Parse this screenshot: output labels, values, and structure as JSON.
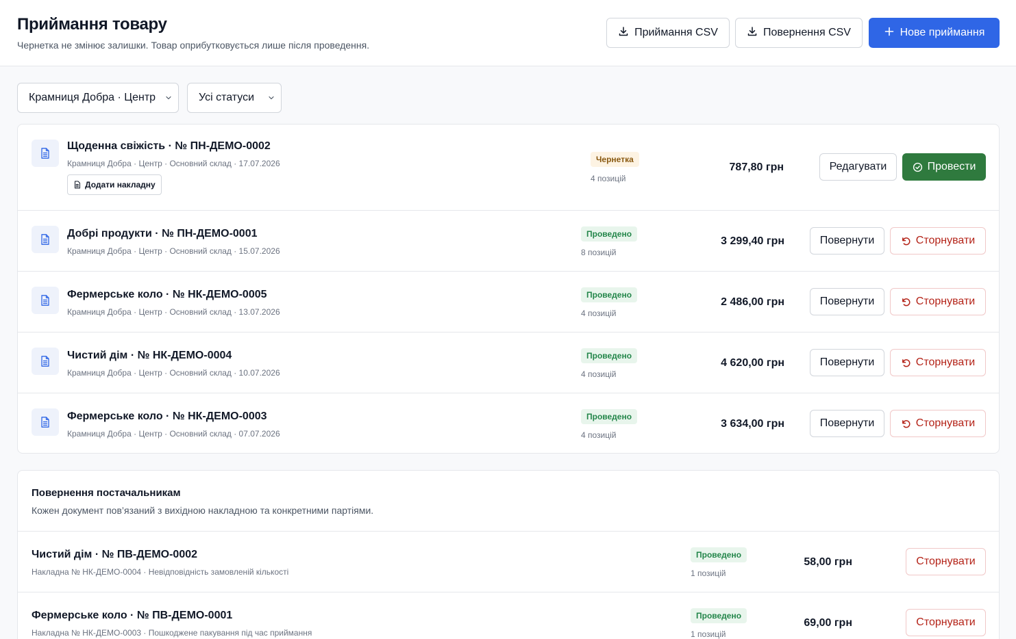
{
  "header": {
    "title": "Приймання товару",
    "subtitle": "Чернетка не змінює залишки. Товар оприбутковується лише після проведення.",
    "receipt_csv": "Приймання CSV",
    "return_csv": "Повернення CSV",
    "new_receipt": "Нове приймання"
  },
  "filters": {
    "store": "Крамниця Добра · Центр",
    "status": "Усі статуси"
  },
  "receipts": [
    {
      "title": "Щоденна свіжість · № ПН-ДЕМО-0002",
      "meta": "Крамниця Добра · Центр · Основний склад · 17.07.2026",
      "attach_label": "Додати накладну",
      "status": "Чернетка",
      "count": "4 позицій",
      "amount": "787,80 грн",
      "edit_label": "Редагувати",
      "post_label": "Провести"
    },
    {
      "title": "Добрі продукти · № ПН-ДЕМО-0001",
      "meta": "Крамниця Добра · Центр · Основний склад · 15.07.2026",
      "status": "Проведено",
      "count": "8 позицій",
      "amount": "3 299,40 грн",
      "return_label": "Повернути",
      "reverse_label": "Сторнувати"
    },
    {
      "title": "Фермерське коло · № НК-ДЕМО-0005",
      "meta": "Крамниця Добра · Центр · Основний склад · 13.07.2026",
      "status": "Проведено",
      "count": "4 позицій",
      "amount": "2 486,00 грн",
      "return_label": "Повернути",
      "reverse_label": "Сторнувати"
    },
    {
      "title": "Чистий дім · № НК-ДЕМО-0004",
      "meta": "Крамниця Добра · Центр · Основний склад · 10.07.2026",
      "status": "Проведено",
      "count": "4 позицій",
      "amount": "4 620,00 грн",
      "return_label": "Повернути",
      "reverse_label": "Сторнувати"
    },
    {
      "title": "Фермерське коло · № НК-ДЕМО-0003",
      "meta": "Крамниця Добра · Центр · Основний склад · 07.07.2026",
      "status": "Проведено",
      "count": "4 позицій",
      "amount": "3 634,00 грн",
      "return_label": "Повернути",
      "reverse_label": "Сторнувати"
    }
  ],
  "returns": {
    "title": "Повернення постачальникам",
    "subtitle": "Кожен документ пов’язаний з вихідною накладною та конкретними партіями.",
    "items": [
      {
        "title": "Чистий дім · № ПВ-ДЕМО-0002",
        "meta": "Накладна № НК-ДЕМО-0004 · Невідповідність замовленій кількості",
        "status": "Проведено",
        "count": "1 позицій",
        "amount": "58,00 грн",
        "reverse_label": "Сторнувати"
      },
      {
        "title": "Фермерське коло · № ПВ-ДЕМО-0001",
        "meta": "Накладна № НК-ДЕМО-0003 · Пошкоджене пакування під час приймання",
        "status": "Проведено",
        "count": "1 позицій",
        "amount": "69,00 грн",
        "reverse_label": "Сторнувати"
      }
    ]
  },
  "colors": {
    "primary": "#2f66e6",
    "success": "#2f7a3e",
    "danger": "#b42318",
    "draft_badge": "#fdf3e3",
    "posted_badge": "#e8f5ec"
  },
  "icons": {
    "download": "download-icon",
    "plus": "plus-icon",
    "document": "document-icon",
    "undo": "undo-icon",
    "check": "check-circle-icon",
    "chevron": "chevron-down-icon"
  }
}
